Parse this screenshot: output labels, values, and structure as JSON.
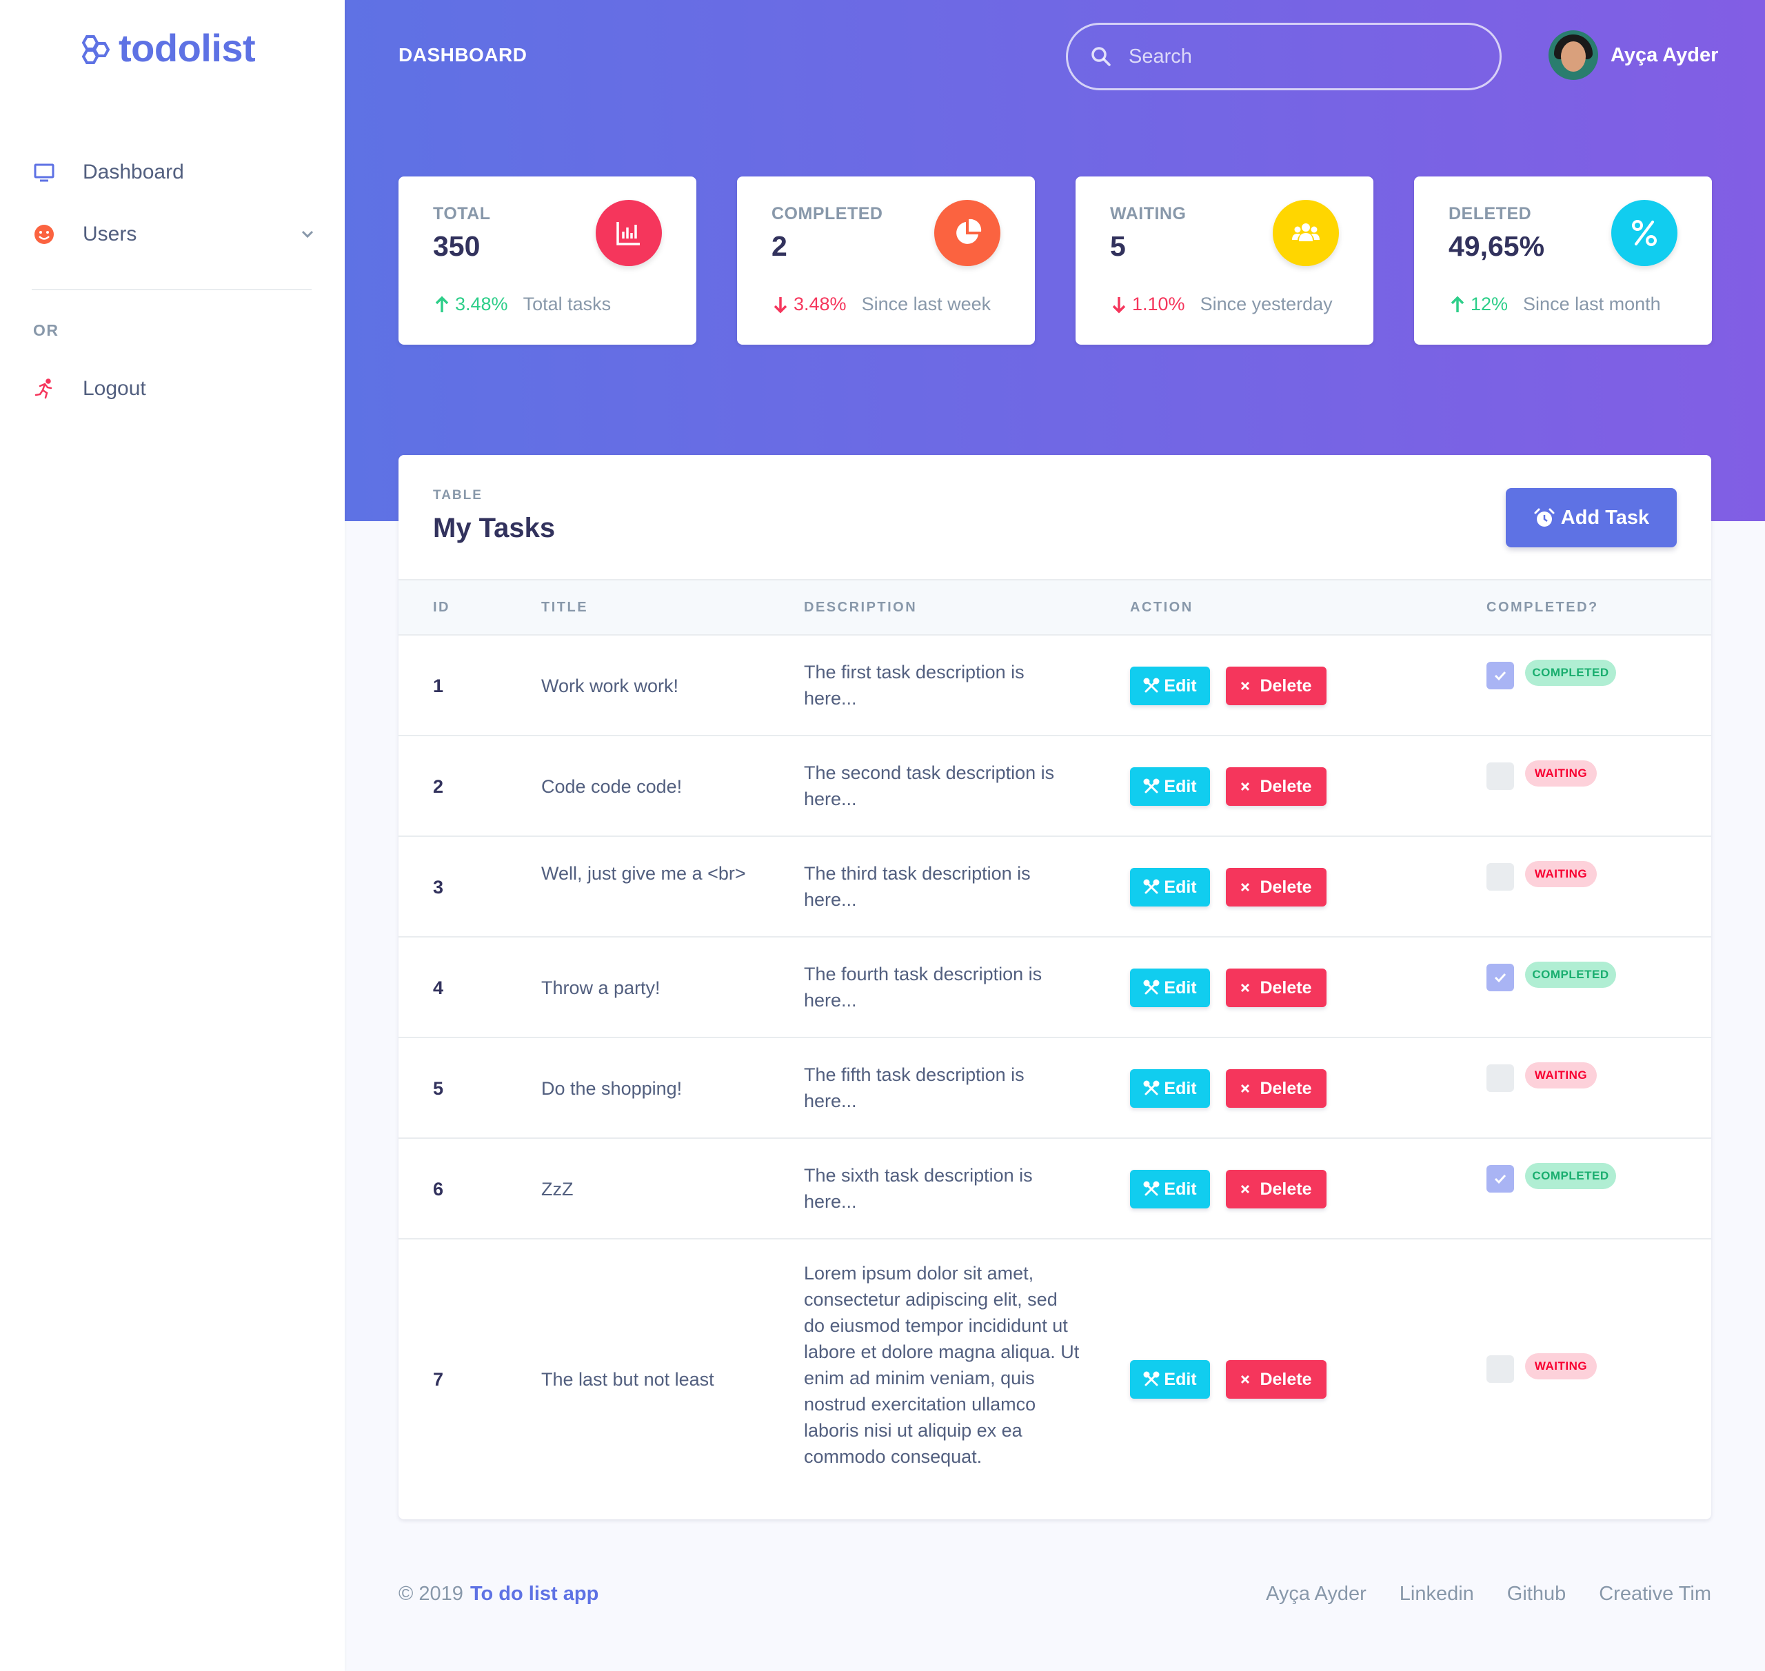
{
  "brand": {
    "name": "todolist",
    "color": "#5e72e4"
  },
  "sidebar": {
    "items": [
      {
        "label": "Dashboard",
        "icon": "tv-icon"
      },
      {
        "label": "Users",
        "icon": "smile-icon"
      }
    ],
    "heading": "OR",
    "logout": {
      "label": "Logout",
      "icon": "running-icon"
    }
  },
  "header": {
    "title": "DASHBOARD",
    "search_placeholder": "Search",
    "user_name": "Ayça Ayder"
  },
  "stats": [
    {
      "label": "TOTAL",
      "value": "350",
      "change": "3.48%",
      "direction": "up",
      "note": "Total tasks",
      "icon": "bar-chart-icon",
      "color": "#f5365c"
    },
    {
      "label": "COMPLETED",
      "value": "2",
      "change": "3.48%",
      "direction": "down",
      "note": "Since last week",
      "icon": "pie-chart-icon",
      "color": "#fb6340"
    },
    {
      "label": "WAITING",
      "value": "5",
      "change": "1.10%",
      "direction": "down",
      "note": "Since yesterday",
      "icon": "users-icon",
      "color": "#ffd600"
    },
    {
      "label": "DELETED",
      "value": "49,65%",
      "change": "12%",
      "direction": "up",
      "note": "Since last month",
      "icon": "percent-icon",
      "color": "#11cdef"
    }
  ],
  "tasks_table": {
    "subtitle": "TABLE",
    "title": "My Tasks",
    "add_button": "Add Task",
    "columns": [
      "ID",
      "TITLE",
      "DESCRIPTION",
      "ACTION",
      "COMPLETED?"
    ],
    "edit_label": "Edit",
    "delete_label": "Delete",
    "rows": [
      {
        "id": "1",
        "title": "Work work work!",
        "description": "The first task description is here...",
        "completed": true,
        "status": "COMPLETED"
      },
      {
        "id": "2",
        "title": "Code code code!",
        "description": "The second task description is here...",
        "completed": false,
        "status": "WAITING"
      },
      {
        "id": "3",
        "title": "Well, just give me a <br>",
        "description": "The third task description is here...",
        "completed": false,
        "status": "WAITING"
      },
      {
        "id": "4",
        "title": "Throw a party!",
        "description": "The fourth task description is here...",
        "completed": true,
        "status": "COMPLETED"
      },
      {
        "id": "5",
        "title": "Do the shopping!",
        "description": "The fifth task description is here...",
        "completed": false,
        "status": "WAITING"
      },
      {
        "id": "6",
        "title": "ZzZ",
        "description": "The sixth task description is here...",
        "completed": true,
        "status": "COMPLETED"
      },
      {
        "id": "7",
        "title": "The last but not least",
        "description": "Lorem ipsum dolor sit amet, consectetur adipiscing elit, sed do eiusmod tempor incididunt ut labore et dolore magna aliqua. Ut enim ad minim veniam, quis nostrud exercitation ullamco laboris nisi ut aliquip ex ea commodo consequat.",
        "completed": false,
        "status": "WAITING"
      }
    ]
  },
  "footer": {
    "copyright": "© 2019",
    "app_link": "To do list app",
    "links": [
      "Ayça Ayder",
      "Linkedin",
      "Github",
      "Creative Tim"
    ]
  }
}
